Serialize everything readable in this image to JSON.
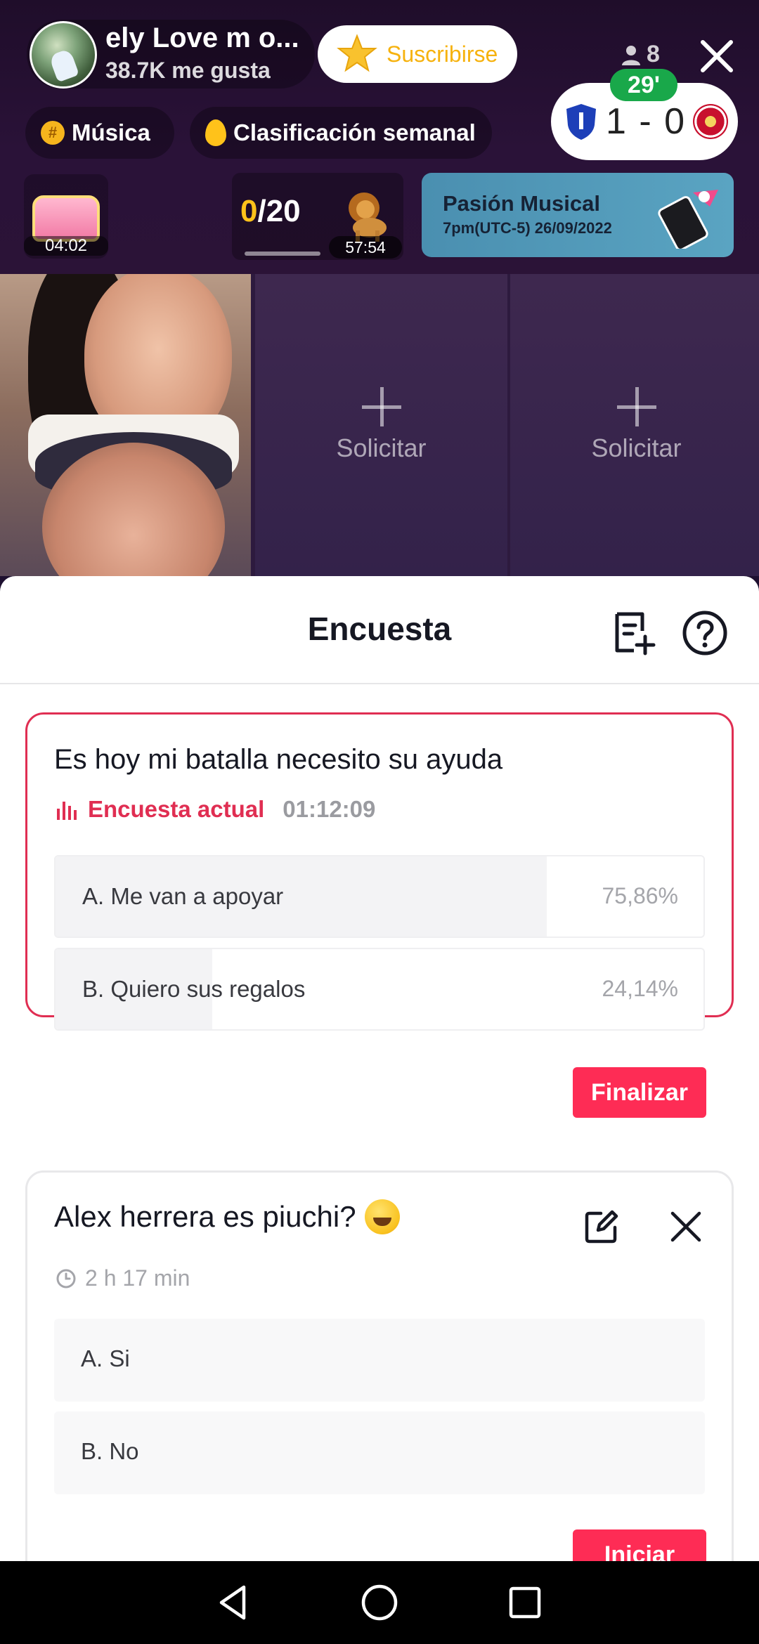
{
  "live": {
    "host_name": "ely Love m o...",
    "host_likes": "38.7K me gusta",
    "subscribe_label": "Suscribirse",
    "viewer_count": "8",
    "chip_music": "Música",
    "chip_ranking": "Clasificación semanal",
    "match": {
      "minute": "29'",
      "score": "1 - 0"
    },
    "chest_timer": "04:02",
    "goal": {
      "current": "0",
      "total": "/20",
      "timer": "57:54"
    },
    "event": {
      "title": "Pasión Musical",
      "subtitle": "7pm(UTC-5) 26/09/2022"
    }
  },
  "tiles": {
    "slot_label_1": "Solicitar",
    "slot_label_2": "Solicitar"
  },
  "sheet": {
    "title": "Encuesta"
  },
  "active_poll": {
    "question": "Es hoy mi batalla necesito su ayuda",
    "status": "Encuesta actual",
    "time_left": "01:12:09",
    "options": [
      {
        "label": "A. Me van a apoyar",
        "percent": "75,86%",
        "share": 0.7586
      },
      {
        "label": "B. Quiero sus regalos",
        "percent": "24,14%",
        "share": 0.2414
      }
    ],
    "finish_label": "Finalizar"
  },
  "draft_poll": {
    "question": "Alex herrera es piuchi?",
    "duration": "2 h 17 min",
    "options": [
      {
        "label": "A. Si"
      },
      {
        "label": "B. No"
      }
    ],
    "start_label": "Iniciar"
  },
  "colors": {
    "accent": "#fe2c55",
    "active_border": "#e02e52",
    "subscribe_text": "#f6b20e",
    "match_green": "#19a84a"
  },
  "icons": [
    "close-icon",
    "person-icon",
    "star-icon",
    "shield-icon",
    "lion-icon",
    "plus-icon",
    "poll-list-add-icon",
    "help-icon",
    "bar-chart-icon",
    "edit-icon",
    "clock-icon",
    "back-icon",
    "home-icon",
    "recent-apps-icon"
  ]
}
